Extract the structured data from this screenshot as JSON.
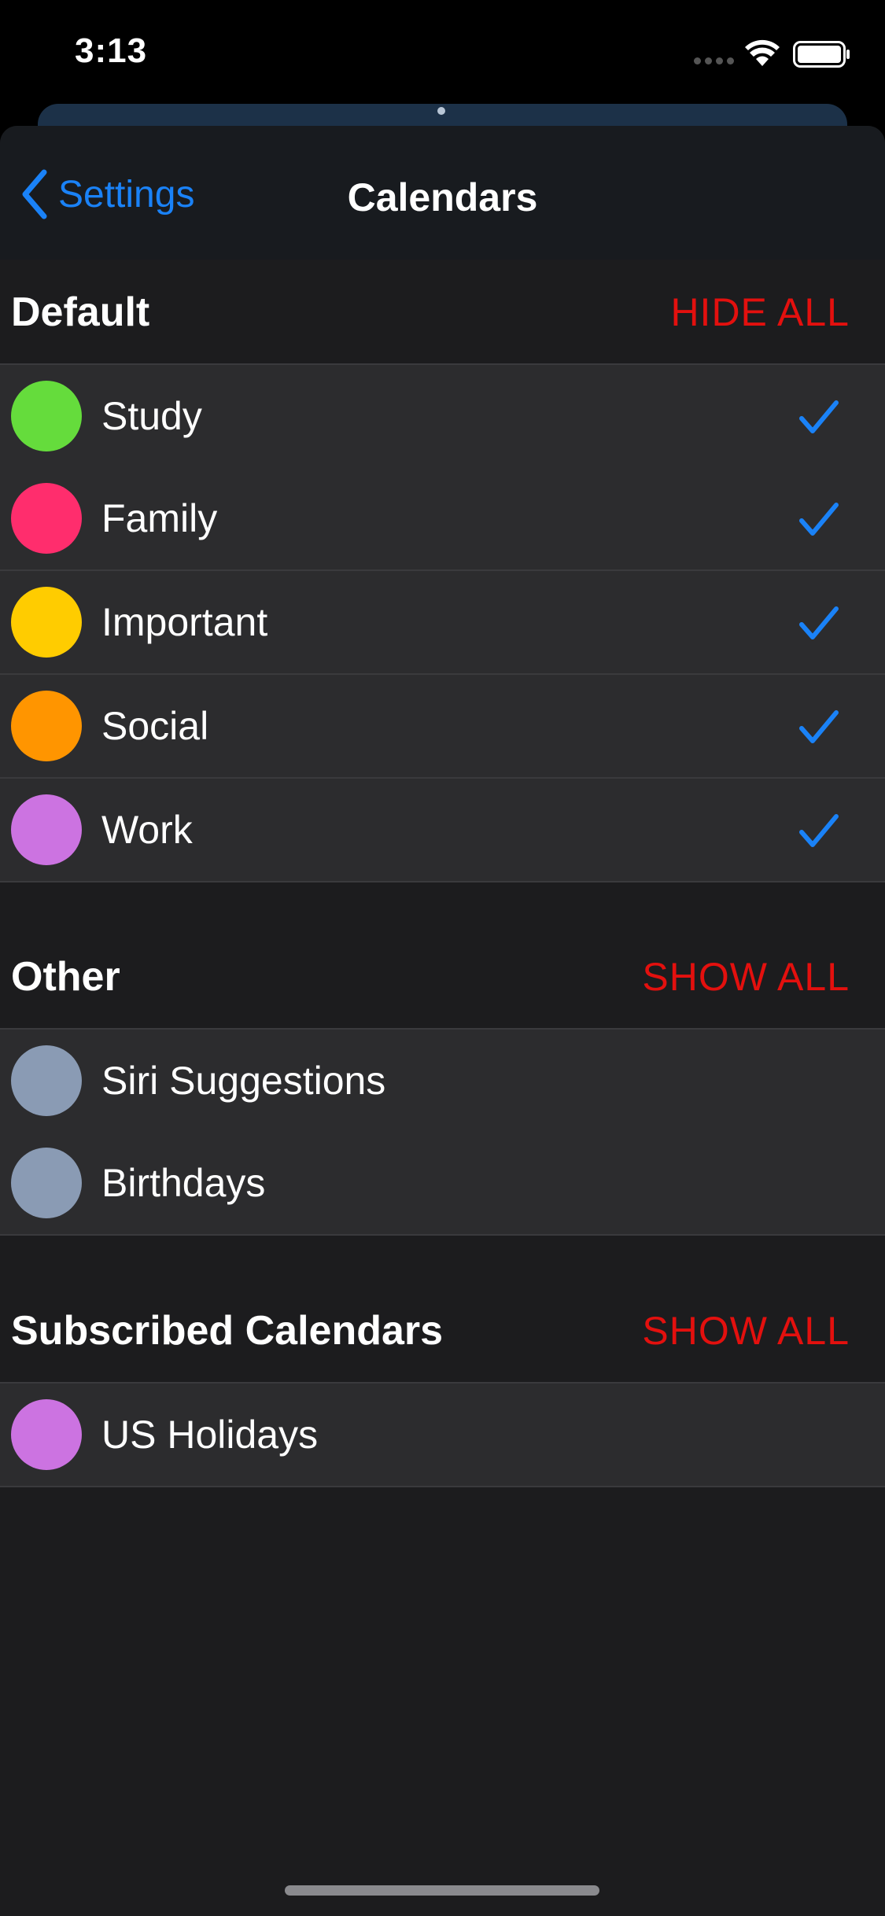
{
  "status_bar": {
    "time": "3:13"
  },
  "nav": {
    "back_label": "Settings",
    "title": "Calendars"
  },
  "sections": [
    {
      "title": "Default",
      "action": "HIDE ALL",
      "items": [
        {
          "label": "Study",
          "color": "#65dc3c",
          "checked": true
        },
        {
          "label": "Family",
          "color": "#ff2d6d",
          "checked": true
        },
        {
          "label": "Important",
          "color": "#ffcc00",
          "checked": true
        },
        {
          "label": "Social",
          "color": "#ff9500",
          "checked": true
        },
        {
          "label": "Work",
          "color": "#cc73e1",
          "checked": true
        }
      ]
    },
    {
      "title": "Other",
      "action": "SHOW ALL",
      "items": [
        {
          "label": "Siri Suggestions",
          "color": "#8a9bb4",
          "checked": false
        },
        {
          "label": "Birthdays",
          "color": "#8a9bb4",
          "checked": false
        }
      ]
    },
    {
      "title": "Subscribed Calendars",
      "action": "SHOW ALL",
      "items": [
        {
          "label": "US Holidays",
          "color": "#cc73e1",
          "checked": false
        }
      ]
    }
  ],
  "colors": {
    "accent": "#1a82f7",
    "action": "#e3100e",
    "background": "#1c1c1e",
    "row": "#2c2c2e"
  },
  "icons": {
    "back": "chevron-left-icon",
    "check": "checkmark-icon",
    "wifi": "wifi-icon",
    "battery": "battery-icon",
    "signal": "signal-icon"
  }
}
